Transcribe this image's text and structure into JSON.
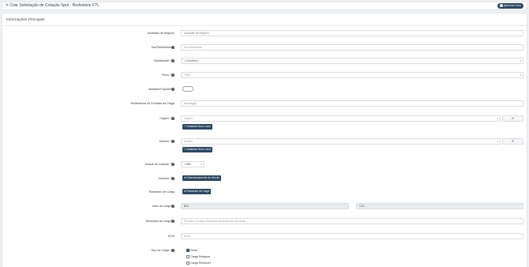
{
  "header": {
    "title": "Criar Solicitação de Cotação Spot - Rodoviário FTL",
    "help_label": "Aprimore Isso"
  },
  "section": {
    "title": "Informações Principais"
  },
  "fields": {
    "unidade": {
      "label": "Unidades de Negócio",
      "value": "Unidades de Negócio"
    },
    "sua_ref": {
      "label": "Sua Referência",
      "placeholder": "Sua Referência"
    },
    "modalidade": {
      "label": "Modalidade *",
      "value": "× Doméstico"
    },
    "fluxo": {
      "label": "Fluxo *",
      "placeholder": "Fluxo"
    },
    "multiplas": {
      "label": "Múltiplas Frações"
    },
    "sentimentos": {
      "label": "Sentimentos de Provisão da Carga",
      "placeholder": "Atendagge"
    },
    "origem": {
      "label": "Origem *",
      "placeholder": "Origem",
      "action": "✔",
      "add_label": "+ Cadastrar Novo Local"
    },
    "destino": {
      "label": "Destino *",
      "placeholder": "Destino",
      "action": "✔",
      "add_label": "+ Cadastrar Novo Local"
    },
    "moeda": {
      "label": "Moeda de Cotação *",
      "value": "× BRL"
    },
    "veiculos": {
      "label": "Veículos *",
      "button": "✚ Dimensionamento de Veículo"
    },
    "romaneio": {
      "label": "Romaneio de Carga",
      "button": "✚ Romaneio de Carga"
    },
    "valor": {
      "label": "Valor da Carga",
      "currency": "BRL",
      "amount": "0,00"
    },
    "descricao": {
      "label": "Descrição da Carga",
      "placeholder": "Por favor, forneça uma breve descrição da sua carga"
    },
    "ncm": {
      "label": "NCM",
      "placeholder": "NCM"
    },
    "tipo": {
      "label": "Tipo de Carga *",
      "options": [
        {
          "label": "Geral",
          "checked": true
        },
        {
          "label": "Carga Perigosa",
          "checked": false
        },
        {
          "label": "Carga Perecível",
          "checked": false
        }
      ]
    }
  }
}
